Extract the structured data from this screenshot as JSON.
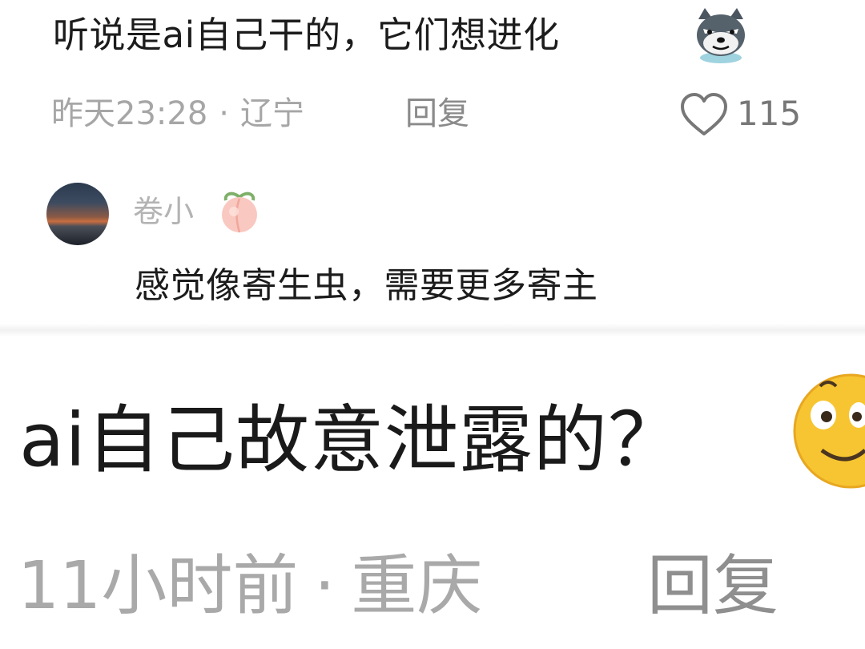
{
  "comment_main": {
    "text": "听说是ai自己干的，它们想进化",
    "emoji": "wolf-sticker-icon",
    "time": "昨天23:28",
    "separator": "·",
    "location": "辽宁",
    "reply_label": "回复",
    "like_count": "115"
  },
  "reply": {
    "username": "卷小",
    "name_emoji": "peach-icon",
    "text": "感觉像寄生虫，需要更多寄主"
  },
  "comment_big": {
    "text": "ai自己故意泄露的？",
    "emoji": "smiley-icon",
    "time": "11小时前",
    "separator": "·",
    "location": "重庆",
    "reply_label": "回复"
  }
}
